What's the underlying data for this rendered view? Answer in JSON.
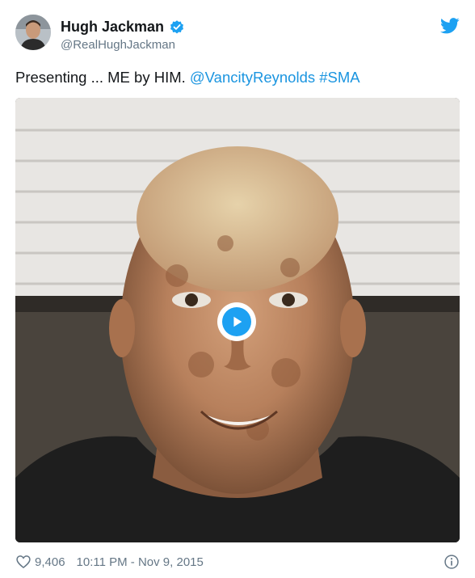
{
  "user": {
    "name": "Hugh Jackman",
    "handle": "@RealHughJackman",
    "verified": true
  },
  "tweet": {
    "text_plain": "Presenting ... ME by HIM.",
    "mention": "@VancityReynolds",
    "hashtag": "#SMA"
  },
  "media": {
    "type": "video",
    "play_icon": "play-icon"
  },
  "footer": {
    "like_count": "9,406",
    "timestamp": "10:11 PM - Nov 9, 2015"
  },
  "colors": {
    "link": "#1b95e0",
    "brand": "#1da1f2",
    "muted": "#657786",
    "text": "#14171a"
  },
  "icons": {
    "verified": "verified-badge-icon",
    "logo": "twitter-bird-icon",
    "like": "heart-icon",
    "info": "info-icon"
  }
}
